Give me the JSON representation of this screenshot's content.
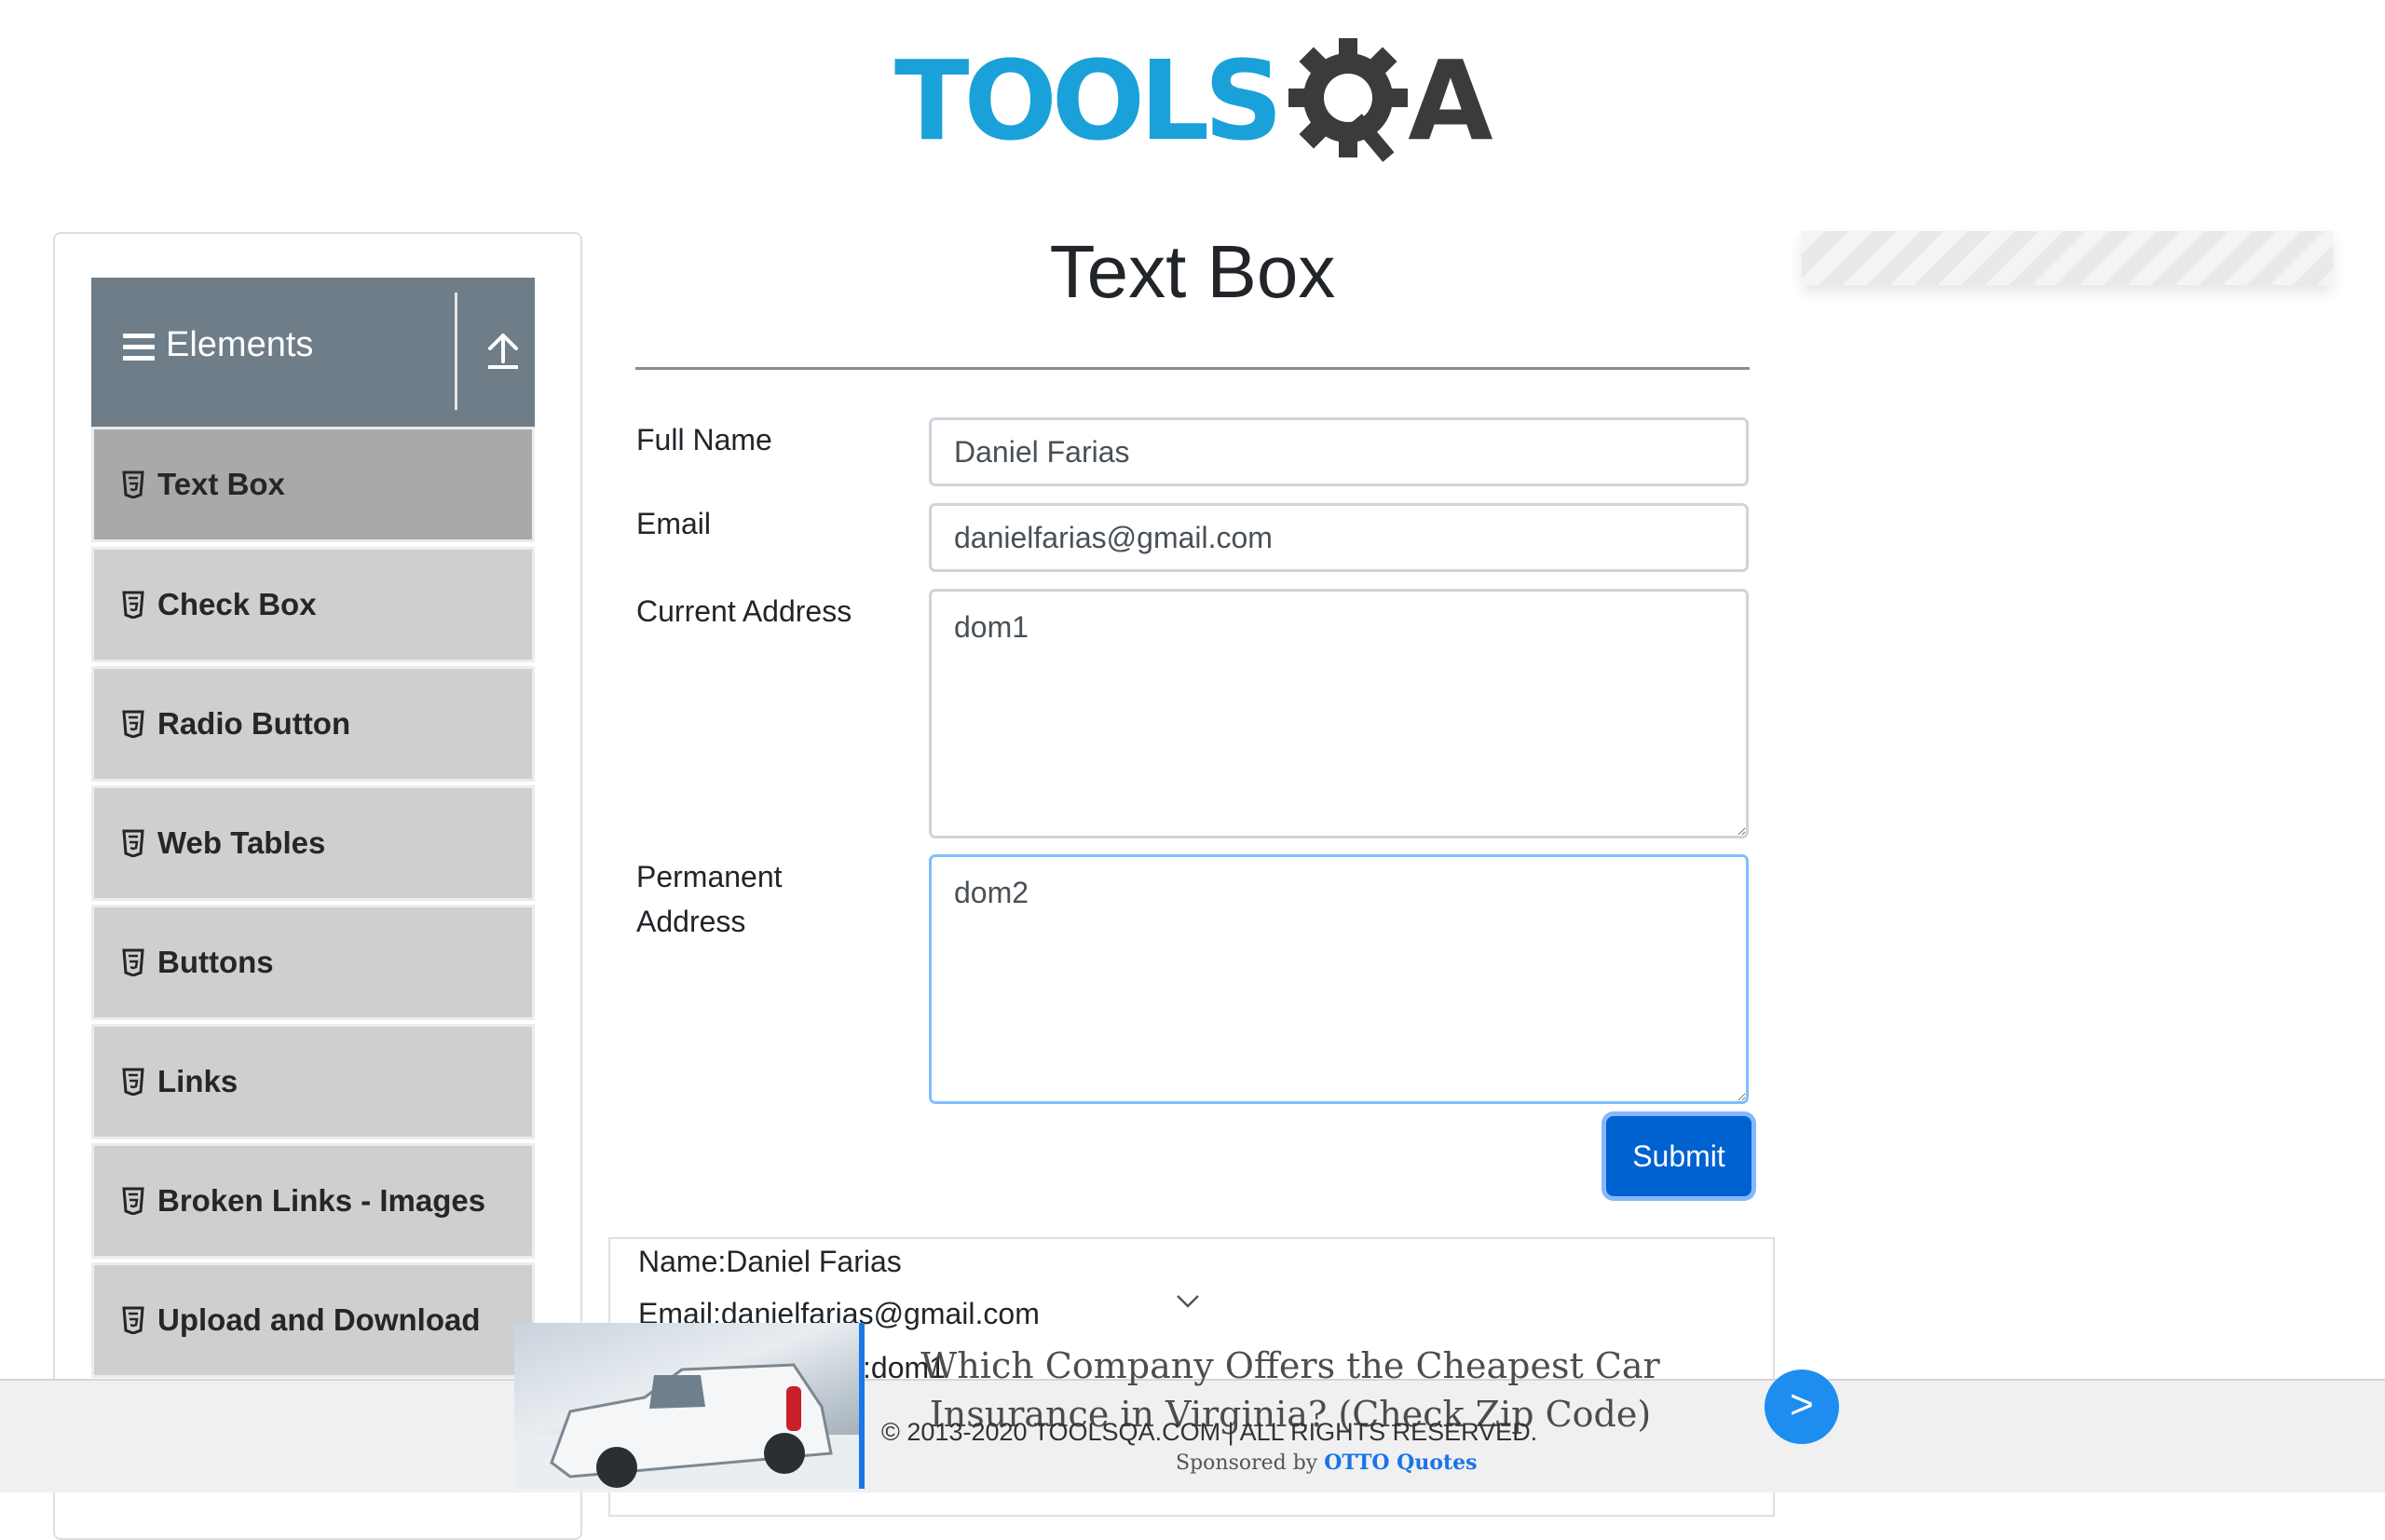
{
  "header": {
    "logo_text_primary": "TOOLS",
    "logo_text_secondary": "A"
  },
  "sidebar": {
    "group_title": "Elements",
    "items": [
      {
        "label": "Text Box",
        "active": true
      },
      {
        "label": "Check Box"
      },
      {
        "label": "Radio Button"
      },
      {
        "label": "Web Tables"
      },
      {
        "label": "Buttons"
      },
      {
        "label": "Links"
      },
      {
        "label": "Broken Links - Images"
      },
      {
        "label": "Upload and Download"
      }
    ]
  },
  "main": {
    "title": "Text Box",
    "form": {
      "full_name_label": "Full Name",
      "full_name_value": "Daniel Farias",
      "email_label": "Email",
      "email_value": "danielfarias@gmail.com",
      "current_address_label": "Current Address",
      "current_address_value": "dom1",
      "permanent_address_label_1": "Permanent",
      "permanent_address_label_2": "Address",
      "permanent_address_value": "dom2",
      "submit_label": "Submit"
    },
    "output": {
      "name": "Name:Daniel Farias",
      "email": "Email:danielfarias@gmail.com",
      "current_address": ":dom1"
    }
  },
  "footer": {
    "copyright": "© 2013-2020 TOOLSQA.COM | ALL RIGHTS RESERVED."
  },
  "ad": {
    "headline": "Which Company Offers the Cheapest Car Insurance in Virginia? (Check Zip Code)",
    "sponsored_by": "Sponsored by",
    "sponsor": "OTTO Quotes",
    "arrow": ">"
  },
  "colors": {
    "brand_blue": "#1aa1d9",
    "sidebar_header": "#6e7d88",
    "submit_button": "#0062d0"
  }
}
